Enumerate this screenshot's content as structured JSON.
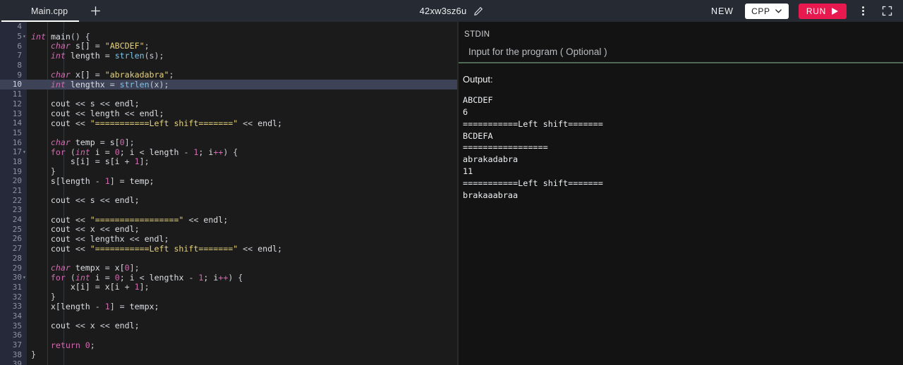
{
  "header": {
    "tab_label": "Main.cpp",
    "new_tab_icon": "plus-icon",
    "project_title": "42xw3sz6u",
    "edit_title_icon": "pencil-icon",
    "new_label": "NEW",
    "language": "CPP",
    "language_chevron_icon": "chevron-down-icon",
    "run_label": "RUN",
    "run_icon": "play-icon",
    "overflow_icon": "kebab-menu-icon",
    "fullscreen_icon": "fullscreen-icon",
    "accent_run_color": "#e8194f",
    "topbar_color": "#262a32"
  },
  "editor": {
    "background": "#1c1b1b",
    "gutter_background": "#25293a",
    "active_line_color": "#3d4257",
    "active_line": 10,
    "first_visible_line": 4,
    "last_visible_line": 39,
    "lines": [
      {
        "n": 4,
        "tokens": []
      },
      {
        "n": 5,
        "fold": true,
        "tokens": [
          {
            "t": "int",
            "c": "kw"
          },
          {
            "t": " ",
            "c": "id"
          },
          {
            "t": "main",
            "c": "id"
          },
          {
            "t": "() {",
            "c": "punc"
          }
        ]
      },
      {
        "n": 6,
        "tokens": [
          {
            "t": "    ",
            "c": "id"
          },
          {
            "t": "char",
            "c": "kw"
          },
          {
            "t": " s[] ",
            "c": "id"
          },
          {
            "t": "=",
            "c": "op"
          },
          {
            "t": " ",
            "c": "id"
          },
          {
            "t": "\"ABCDEF\"",
            "c": "str"
          },
          {
            "t": ";",
            "c": "punc"
          }
        ]
      },
      {
        "n": 7,
        "tokens": [
          {
            "t": "    ",
            "c": "id"
          },
          {
            "t": "int",
            "c": "kw"
          },
          {
            "t": " length ",
            "c": "id"
          },
          {
            "t": "=",
            "c": "op"
          },
          {
            "t": " ",
            "c": "id"
          },
          {
            "t": "strlen",
            "c": "fn"
          },
          {
            "t": "(s);",
            "c": "punc"
          }
        ]
      },
      {
        "n": 8,
        "tokens": []
      },
      {
        "n": 9,
        "tokens": [
          {
            "t": "    ",
            "c": "id"
          },
          {
            "t": "char",
            "c": "kw"
          },
          {
            "t": " x[] ",
            "c": "id"
          },
          {
            "t": "=",
            "c": "op"
          },
          {
            "t": " ",
            "c": "id"
          },
          {
            "t": "\"abrakadabra\"",
            "c": "str"
          },
          {
            "t": ";",
            "c": "punc"
          }
        ]
      },
      {
        "n": 10,
        "tokens": [
          {
            "t": "    ",
            "c": "id"
          },
          {
            "t": "int",
            "c": "kw"
          },
          {
            "t": " lengthx ",
            "c": "id"
          },
          {
            "t": "=",
            "c": "op"
          },
          {
            "t": " ",
            "c": "id"
          },
          {
            "t": "strlen",
            "c": "fn"
          },
          {
            "t": "(x);",
            "c": "punc"
          }
        ]
      },
      {
        "n": 11,
        "tokens": []
      },
      {
        "n": 12,
        "tokens": [
          {
            "t": "    cout ",
            "c": "id"
          },
          {
            "t": "<<",
            "c": "op"
          },
          {
            "t": " s ",
            "c": "id"
          },
          {
            "t": "<<",
            "c": "op"
          },
          {
            "t": " endl;",
            "c": "id"
          }
        ]
      },
      {
        "n": 13,
        "tokens": [
          {
            "t": "    cout ",
            "c": "id"
          },
          {
            "t": "<<",
            "c": "op"
          },
          {
            "t": " length ",
            "c": "id"
          },
          {
            "t": "<<",
            "c": "op"
          },
          {
            "t": " endl;",
            "c": "id"
          }
        ]
      },
      {
        "n": 14,
        "tokens": [
          {
            "t": "    cout ",
            "c": "id"
          },
          {
            "t": "<<",
            "c": "op"
          },
          {
            "t": " ",
            "c": "id"
          },
          {
            "t": "\"===========Left shift=======\"",
            "c": "str"
          },
          {
            "t": " ",
            "c": "id"
          },
          {
            "t": "<<",
            "c": "op"
          },
          {
            "t": " endl;",
            "c": "id"
          }
        ]
      },
      {
        "n": 15,
        "tokens": []
      },
      {
        "n": 16,
        "tokens": [
          {
            "t": "    ",
            "c": "id"
          },
          {
            "t": "char",
            "c": "kw"
          },
          {
            "t": " temp ",
            "c": "id"
          },
          {
            "t": "=",
            "c": "op"
          },
          {
            "t": " s[",
            "c": "id"
          },
          {
            "t": "0",
            "c": "num"
          },
          {
            "t": "];",
            "c": "punc"
          }
        ]
      },
      {
        "n": 17,
        "fold": true,
        "tokens": [
          {
            "t": "    ",
            "c": "id"
          },
          {
            "t": "for",
            "c": "kw2"
          },
          {
            "t": " (",
            "c": "punc"
          },
          {
            "t": "int",
            "c": "kw"
          },
          {
            "t": " i ",
            "c": "id"
          },
          {
            "t": "=",
            "c": "op"
          },
          {
            "t": " ",
            "c": "id"
          },
          {
            "t": "0",
            "c": "num"
          },
          {
            "t": "; i ",
            "c": "id"
          },
          {
            "t": "<",
            "c": "op"
          },
          {
            "t": " length ",
            "c": "id"
          },
          {
            "t": "-",
            "c": "op"
          },
          {
            "t": " ",
            "c": "id"
          },
          {
            "t": "1",
            "c": "num"
          },
          {
            "t": "; i",
            "c": "id"
          },
          {
            "t": "++",
            "c": "num"
          },
          {
            "t": ") {",
            "c": "punc"
          }
        ]
      },
      {
        "n": 18,
        "tokens": [
          {
            "t": "        s[i] ",
            "c": "id"
          },
          {
            "t": "=",
            "c": "op"
          },
          {
            "t": " s[i ",
            "c": "id"
          },
          {
            "t": "+",
            "c": "op"
          },
          {
            "t": " ",
            "c": "id"
          },
          {
            "t": "1",
            "c": "num"
          },
          {
            "t": "];",
            "c": "punc"
          }
        ]
      },
      {
        "n": 19,
        "tokens": [
          {
            "t": "    }",
            "c": "punc"
          }
        ]
      },
      {
        "n": 20,
        "tokens": [
          {
            "t": "    s[length ",
            "c": "id"
          },
          {
            "t": "-",
            "c": "op"
          },
          {
            "t": " ",
            "c": "id"
          },
          {
            "t": "1",
            "c": "num"
          },
          {
            "t": "] ",
            "c": "punc"
          },
          {
            "t": "=",
            "c": "op"
          },
          {
            "t": " temp;",
            "c": "id"
          }
        ]
      },
      {
        "n": 21,
        "tokens": []
      },
      {
        "n": 22,
        "tokens": [
          {
            "t": "    cout ",
            "c": "id"
          },
          {
            "t": "<<",
            "c": "op"
          },
          {
            "t": " s ",
            "c": "id"
          },
          {
            "t": "<<",
            "c": "op"
          },
          {
            "t": " endl;",
            "c": "id"
          }
        ]
      },
      {
        "n": 23,
        "tokens": []
      },
      {
        "n": 24,
        "tokens": [
          {
            "t": "    cout ",
            "c": "id"
          },
          {
            "t": "<<",
            "c": "op"
          },
          {
            "t": " ",
            "c": "id"
          },
          {
            "t": "\"=================\"",
            "c": "str"
          },
          {
            "t": " ",
            "c": "id"
          },
          {
            "t": "<<",
            "c": "op"
          },
          {
            "t": " endl;",
            "c": "id"
          }
        ]
      },
      {
        "n": 25,
        "tokens": [
          {
            "t": "    cout ",
            "c": "id"
          },
          {
            "t": "<<",
            "c": "op"
          },
          {
            "t": " x ",
            "c": "id"
          },
          {
            "t": "<<",
            "c": "op"
          },
          {
            "t": " endl;",
            "c": "id"
          }
        ]
      },
      {
        "n": 26,
        "tokens": [
          {
            "t": "    cout ",
            "c": "id"
          },
          {
            "t": "<<",
            "c": "op"
          },
          {
            "t": " lengthx ",
            "c": "id"
          },
          {
            "t": "<<",
            "c": "op"
          },
          {
            "t": " endl;",
            "c": "id"
          }
        ]
      },
      {
        "n": 27,
        "tokens": [
          {
            "t": "    cout ",
            "c": "id"
          },
          {
            "t": "<<",
            "c": "op"
          },
          {
            "t": " ",
            "c": "id"
          },
          {
            "t": "\"===========Left shift=======\"",
            "c": "str"
          },
          {
            "t": " ",
            "c": "id"
          },
          {
            "t": "<<",
            "c": "op"
          },
          {
            "t": " endl;",
            "c": "id"
          }
        ]
      },
      {
        "n": 28,
        "tokens": []
      },
      {
        "n": 29,
        "tokens": [
          {
            "t": "    ",
            "c": "id"
          },
          {
            "t": "char",
            "c": "kw"
          },
          {
            "t": " tempx ",
            "c": "id"
          },
          {
            "t": "=",
            "c": "op"
          },
          {
            "t": " x[",
            "c": "id"
          },
          {
            "t": "0",
            "c": "num"
          },
          {
            "t": "];",
            "c": "punc"
          }
        ]
      },
      {
        "n": 30,
        "fold": true,
        "tokens": [
          {
            "t": "    ",
            "c": "id"
          },
          {
            "t": "for",
            "c": "kw2"
          },
          {
            "t": " (",
            "c": "punc"
          },
          {
            "t": "int",
            "c": "kw"
          },
          {
            "t": " i ",
            "c": "id"
          },
          {
            "t": "=",
            "c": "op"
          },
          {
            "t": " ",
            "c": "id"
          },
          {
            "t": "0",
            "c": "num"
          },
          {
            "t": "; i ",
            "c": "id"
          },
          {
            "t": "<",
            "c": "op"
          },
          {
            "t": " lengthx ",
            "c": "id"
          },
          {
            "t": "-",
            "c": "op"
          },
          {
            "t": " ",
            "c": "id"
          },
          {
            "t": "1",
            "c": "num"
          },
          {
            "t": "; i",
            "c": "id"
          },
          {
            "t": "++",
            "c": "num"
          },
          {
            "t": ") {",
            "c": "punc"
          }
        ]
      },
      {
        "n": 31,
        "tokens": [
          {
            "t": "        x[i] ",
            "c": "id"
          },
          {
            "t": "=",
            "c": "op"
          },
          {
            "t": " x[i ",
            "c": "id"
          },
          {
            "t": "+",
            "c": "op"
          },
          {
            "t": " ",
            "c": "id"
          },
          {
            "t": "1",
            "c": "num"
          },
          {
            "t": "];",
            "c": "punc"
          }
        ]
      },
      {
        "n": 32,
        "tokens": [
          {
            "t": "    }",
            "c": "punc"
          }
        ]
      },
      {
        "n": 33,
        "tokens": [
          {
            "t": "    x[length ",
            "c": "id"
          },
          {
            "t": "-",
            "c": "op"
          },
          {
            "t": " ",
            "c": "id"
          },
          {
            "t": "1",
            "c": "num"
          },
          {
            "t": "] ",
            "c": "punc"
          },
          {
            "t": "=",
            "c": "op"
          },
          {
            "t": " tempx;",
            "c": "id"
          }
        ]
      },
      {
        "n": 34,
        "tokens": []
      },
      {
        "n": 35,
        "tokens": [
          {
            "t": "    cout ",
            "c": "id"
          },
          {
            "t": "<<",
            "c": "op"
          },
          {
            "t": " x ",
            "c": "id"
          },
          {
            "t": "<<",
            "c": "op"
          },
          {
            "t": " endl;",
            "c": "id"
          }
        ]
      },
      {
        "n": 36,
        "tokens": []
      },
      {
        "n": 37,
        "tokens": [
          {
            "t": "    ",
            "c": "id"
          },
          {
            "t": "return",
            "c": "kw2"
          },
          {
            "t": " ",
            "c": "id"
          },
          {
            "t": "0",
            "c": "num"
          },
          {
            "t": ";",
            "c": "punc"
          }
        ]
      },
      {
        "n": 38,
        "tokens": [
          {
            "t": "}",
            "c": "punc"
          }
        ]
      },
      {
        "n": 39,
        "tokens": []
      }
    ]
  },
  "output_panel": {
    "stdin_label": "STDIN",
    "stdin_value": "",
    "stdin_placeholder": "Input for the program ( Optional )",
    "stdin_underline_color": "#4f6b57",
    "output_label": "Output:",
    "output_lines": [
      "ABCDEF",
      "6",
      "===========Left shift=======",
      "BCDEFA",
      "=================",
      "abrakadabra",
      "11",
      "===========Left shift=======",
      "brakaaabraa"
    ]
  }
}
